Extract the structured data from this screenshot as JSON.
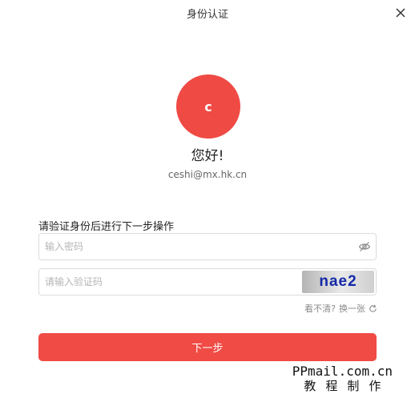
{
  "dialog": {
    "title": "身份认证"
  },
  "user": {
    "avatar_letter": "c",
    "greeting": "您好!",
    "email": "ceshi@mx.hk.cn"
  },
  "form": {
    "prompt": "请验证身份后进行下一步操作",
    "password_placeholder": "输入密码",
    "captcha_placeholder": "请输入验证码",
    "captcha_text": "nae2",
    "cant_see": "看不清?",
    "refresh_label": "换一张",
    "next_label": "下一步"
  },
  "watermark": {
    "line1": "PPmail.com.cn",
    "line2": "教程制作"
  },
  "colors": {
    "accent": "#f04b45",
    "avatar_bg": "#ef4a44"
  },
  "icons": {
    "close": "close-icon",
    "eye": "eye-hidden-icon",
    "refresh": "refresh-icon"
  }
}
